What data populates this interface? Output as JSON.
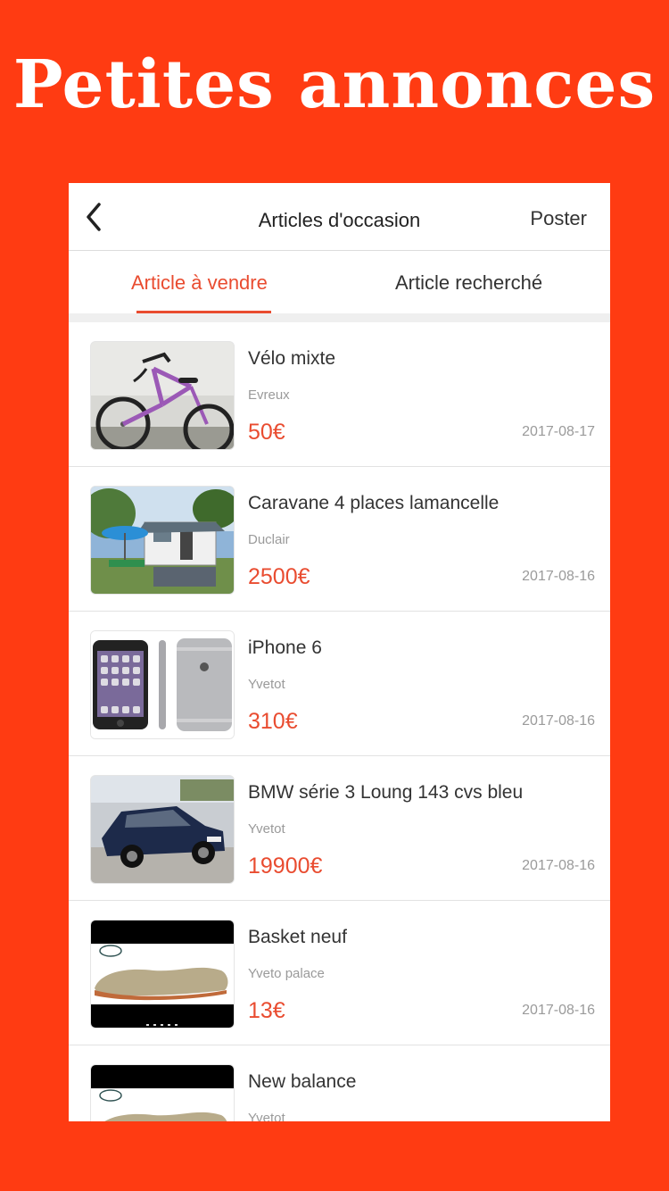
{
  "banner": {
    "title": "Petites annonces"
  },
  "navbar": {
    "title": "Articles d'occasion",
    "action": "Poster"
  },
  "tabs": [
    {
      "label": "Article à vendre",
      "active": true
    },
    {
      "label": "Article recherché",
      "active": false
    }
  ],
  "colors": {
    "background": "#FF3B12",
    "accent": "#E94C30"
  },
  "items": [
    {
      "title": "Vélo mixte",
      "location": "Evreux",
      "price": "50€",
      "date": "2017-08-17",
      "image": "bicycle-photo"
    },
    {
      "title": "Caravane 4 places lamancelle",
      "location": "Duclair",
      "price": "2500€",
      "date": "2017-08-16",
      "image": "caravan-photo"
    },
    {
      "title": "iPhone 6",
      "location": "Yvetot",
      "price": "310€",
      "date": "2017-08-16",
      "image": "iphone-photo"
    },
    {
      "title": "BMW série 3 Loung 143 cvs bleu",
      "location": "Yvetot",
      "price": "19900€",
      "date": "2017-08-16",
      "image": "car-photo"
    },
    {
      "title": "Basket neuf",
      "location": "Yveto palace",
      "price": "13€",
      "date": "2017-08-16",
      "image": "shoe-photo"
    },
    {
      "title": "New balance",
      "location": "Yvetot",
      "price": "",
      "date": "",
      "image": "shoe-photo"
    }
  ]
}
